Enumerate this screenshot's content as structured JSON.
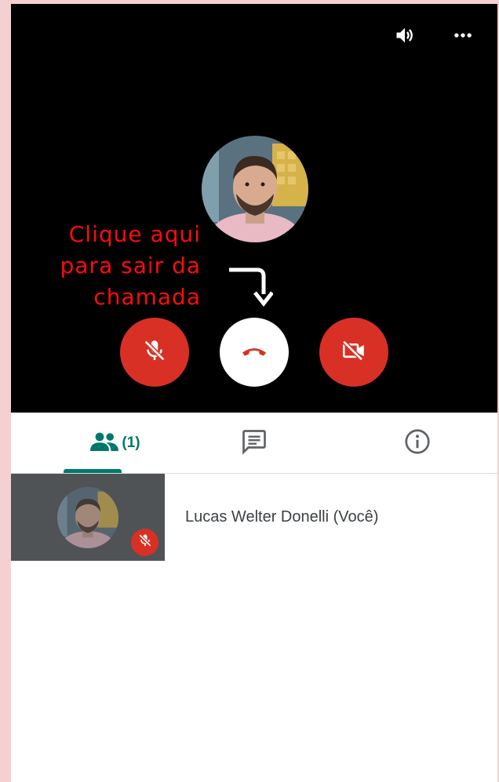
{
  "call": {
    "hint_text_lines": [
      "Clique aqui",
      "para sair da",
      "chamada"
    ],
    "icons": {
      "speaker": "speaker-icon",
      "more": "more-options-icon",
      "mic": "mic-off-icon",
      "hangup": "hang-up-icon",
      "camera": "camera-off-icon"
    }
  },
  "tabs": {
    "people_count": "(1)",
    "items": [
      {
        "name": "people",
        "icon": "people-icon"
      },
      {
        "name": "chat",
        "icon": "chat-icon"
      },
      {
        "name": "info",
        "icon": "info-icon"
      }
    ]
  },
  "participants": [
    {
      "name": "Lucas Welter Donelli (Você)",
      "muted": true
    }
  ],
  "colors": {
    "accent": "#00796b",
    "danger": "#d93025",
    "hint": "#ff0b0b",
    "background": "#f4d0d3"
  }
}
